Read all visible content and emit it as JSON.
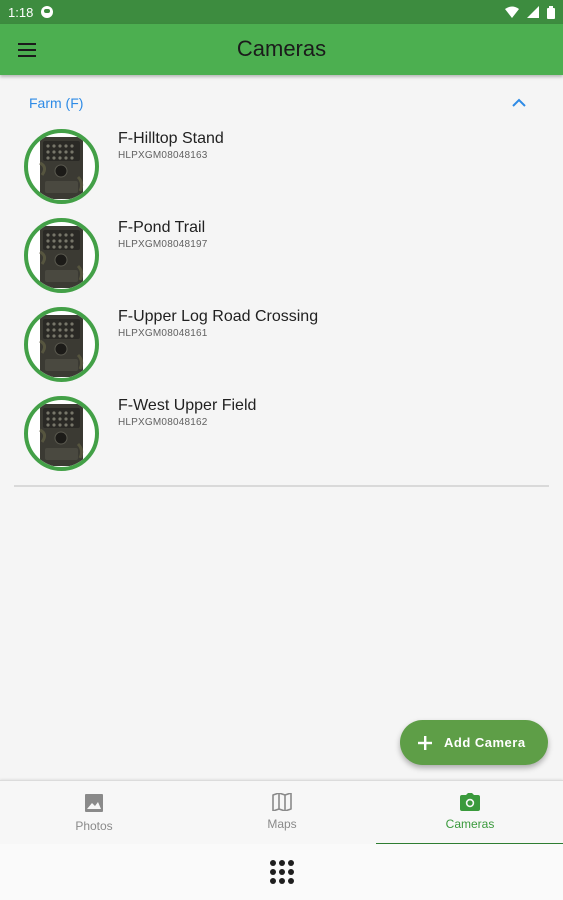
{
  "status_bar": {
    "time": "1:18",
    "icons": [
      "notification-icon",
      "wifi-icon",
      "signal-icon",
      "battery-icon"
    ]
  },
  "app_bar": {
    "title": "Cameras",
    "menu_icon": "hamburger-menu-icon"
  },
  "group": {
    "label": "Farm (F)",
    "collapse_icon": "chevron-up-icon"
  },
  "cameras": [
    {
      "name": "F-Hilltop Stand",
      "serial": "HLPXGM08048163"
    },
    {
      "name": "F-Pond Trail",
      "serial": "HLPXGM08048197"
    },
    {
      "name": "F-Upper Log Road Crossing",
      "serial": "HLPXGM08048161"
    },
    {
      "name": "F-West Upper Field",
      "serial": "HLPXGM08048162"
    }
  ],
  "fab": {
    "label": "Add Camera",
    "icon": "plus-icon"
  },
  "bottom_nav": [
    {
      "label": "Photos",
      "icon": "image-icon",
      "active": false
    },
    {
      "label": "Maps",
      "icon": "map-icon",
      "active": false
    },
    {
      "label": "Cameras",
      "icon": "camera-icon",
      "active": true
    }
  ],
  "colors": {
    "primary": "#4caf50",
    "status_bar": "#3d8c3f",
    "accent_link": "#2e8be6",
    "active_nav": "#3a9a3c",
    "fab": "#5e9e47",
    "avatar_ring": "#43a047"
  }
}
